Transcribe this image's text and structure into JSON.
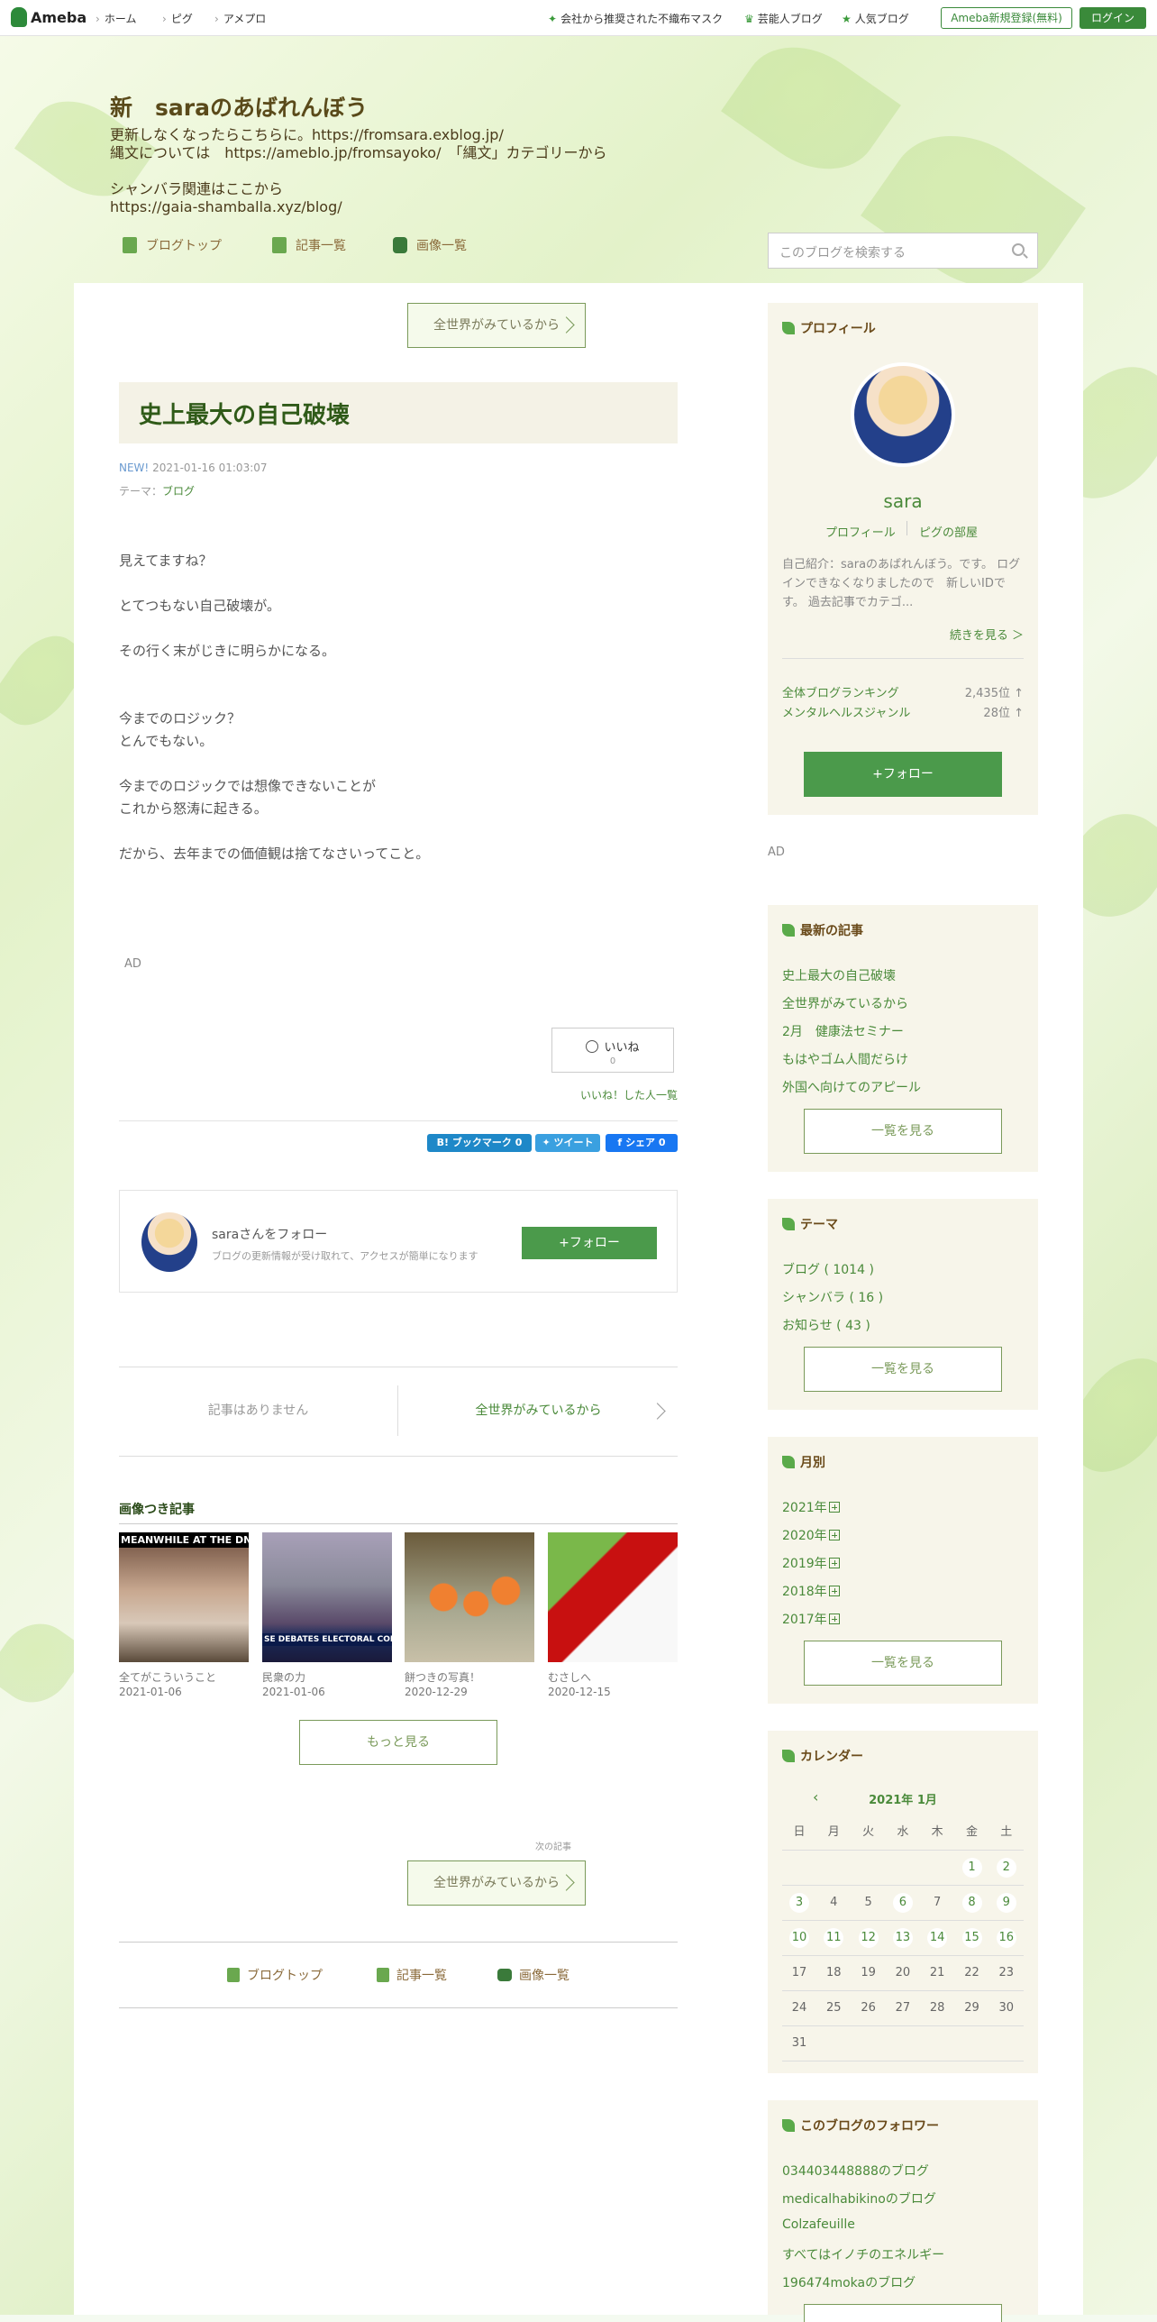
{
  "topbar": {
    "logo": "Ameba",
    "nav": [
      "ホーム",
      "ピグ",
      "アメプロ"
    ],
    "links": [
      "会社から推奨された不織布マスク",
      "芸能人ブログ",
      "人気ブログ"
    ],
    "register": "Ameba新規登録(無料)",
    "login": "ログイン"
  },
  "header": {
    "blog_title": "新　saraのあばれんぼう",
    "description": "更新しなくなったらこちらに。https://fromsara.exblog.jp/\n縄文については　https://ameblo.jp/fromsayoko/　「縄文」カテゴリーから\n\nシャンバラ関連はここから\nhttps://gaia-shamballa.xyz/blog/",
    "nav": [
      "ブログトップ",
      "記事一覧",
      "画像一覧"
    ],
    "search_placeholder": "このブログを検索する"
  },
  "article": {
    "prev_link": "全世界がみているから",
    "title": "史上最大の自己破壊",
    "new_label": "NEW!",
    "date": "2021-01-16 01:03:07",
    "theme_label": "テーマ：",
    "theme": "ブログ",
    "body": "見えてますね？\n\nとてつもない自己破壊が。\n\nその行く末がじきに明らかになる。\n\n\n今までのロジック？\nとんでもない。\n\n今までのロジックでは想像できないことが\nこれから怒涛に起きる。\n\nだから、去年までの価値観は捨てなさいってこと。",
    "ad": "AD",
    "iine_label": "いいね",
    "iine_count": "0",
    "iine_list": "いいね！した人一覧",
    "share": {
      "hatena": "B! ブックマーク",
      "hatena_count": "0",
      "tweet": "ツイート",
      "facebook": "シェア",
      "facebook_count": "0"
    },
    "follow_title": "saraさんをフォロー",
    "follow_desc": "ブログの更新情報が受け取れて、アクセスが簡単になります",
    "follow_btn": "+フォロー",
    "pager_none": "記事はありません",
    "pager_next": "全世界がみているから",
    "image_section": "画像つき記事",
    "image_posts": [
      {
        "title": "全てがこういうこと",
        "date": "2021-01-06",
        "overlay": "MEANWHILE AT THE DNC"
      },
      {
        "title": "民衆の力",
        "date": "2021-01-06",
        "overlay": "SE DEBATES ELECTORAL COLLEGE OB"
      },
      {
        "title": "餅つきの写真！",
        "date": "2020-12-29",
        "overlay": ""
      },
      {
        "title": "むさしへ",
        "date": "2020-12-15",
        "overlay": ""
      }
    ],
    "more": "もっと見る",
    "next_label": "次の記事",
    "next_link": "全世界がみているから",
    "bottom_nav": [
      "ブログトップ",
      "記事一覧",
      "画像一覧"
    ]
  },
  "sidebar": {
    "profile": {
      "title": "プロフィール",
      "name": "sara",
      "links": [
        "プロフィール",
        "ピグの部屋"
      ],
      "intro": "自己紹介：saraのあばれんぼう。です。 ログインできなくなりましたので　新しいIDです。 過去記事でカテゴ...",
      "more": "続きを見る ＞",
      "rank_all_label": "全体ブログランキング",
      "rank_all": "2,435位 ↑",
      "rank_genre_label": "メンタルヘルスジャンル",
      "rank_genre": "28位 ↑",
      "follow": "+フォロー"
    },
    "ad": "AD",
    "recent": {
      "title": "最新の記事",
      "items": [
        "史上最大の自己破壊",
        "全世界がみているから",
        "2月　健康法セミナー",
        "もはやゴム人間だらけ",
        "外国へ向けてのアピール"
      ],
      "btn": "一覧を見る"
    },
    "themes": {
      "title": "テーマ",
      "items": [
        "ブログ ( 1014 )",
        "シャンバラ ( 16 )",
        "お知らせ ( 43 )"
      ],
      "btn": "一覧を見る"
    },
    "monthly": {
      "title": "月別",
      "items": [
        "2021年",
        "2020年",
        "2019年",
        "2018年",
        "2017年"
      ],
      "btn": "一覧を見る"
    },
    "calendar": {
      "title": "カレンダー",
      "month": "2021年 1月",
      "weekdays": [
        "日",
        "月",
        "火",
        "水",
        "木",
        "金",
        "土"
      ],
      "weeks": [
        [
          "",
          "",
          "",
          "",
          "",
          "1",
          "2"
        ],
        [
          "3",
          "4",
          "5",
          "6",
          "7",
          "8",
          "9"
        ],
        [
          "10",
          "11",
          "12",
          "13",
          "14",
          "15",
          "16"
        ],
        [
          "17",
          "18",
          "19",
          "20",
          "21",
          "22",
          "23"
        ],
        [
          "24",
          "25",
          "26",
          "27",
          "28",
          "29",
          "30"
        ],
        [
          "31",
          "",
          "",
          "",
          "",
          "",
          ""
        ]
      ],
      "linked_days": [
        "1",
        "2",
        "3",
        "6",
        "8",
        "9",
        "10",
        "11",
        "12",
        "13",
        "14",
        "15",
        "16"
      ]
    },
    "followers": {
      "title": "このブログのフォロワー",
      "items": [
        "034403448888のブログ",
        "medicalhabikinoのブログ",
        "Colzafeuille",
        "すべてはイノチのエネルギー",
        "196474mokaのブログ"
      ]
    }
  }
}
